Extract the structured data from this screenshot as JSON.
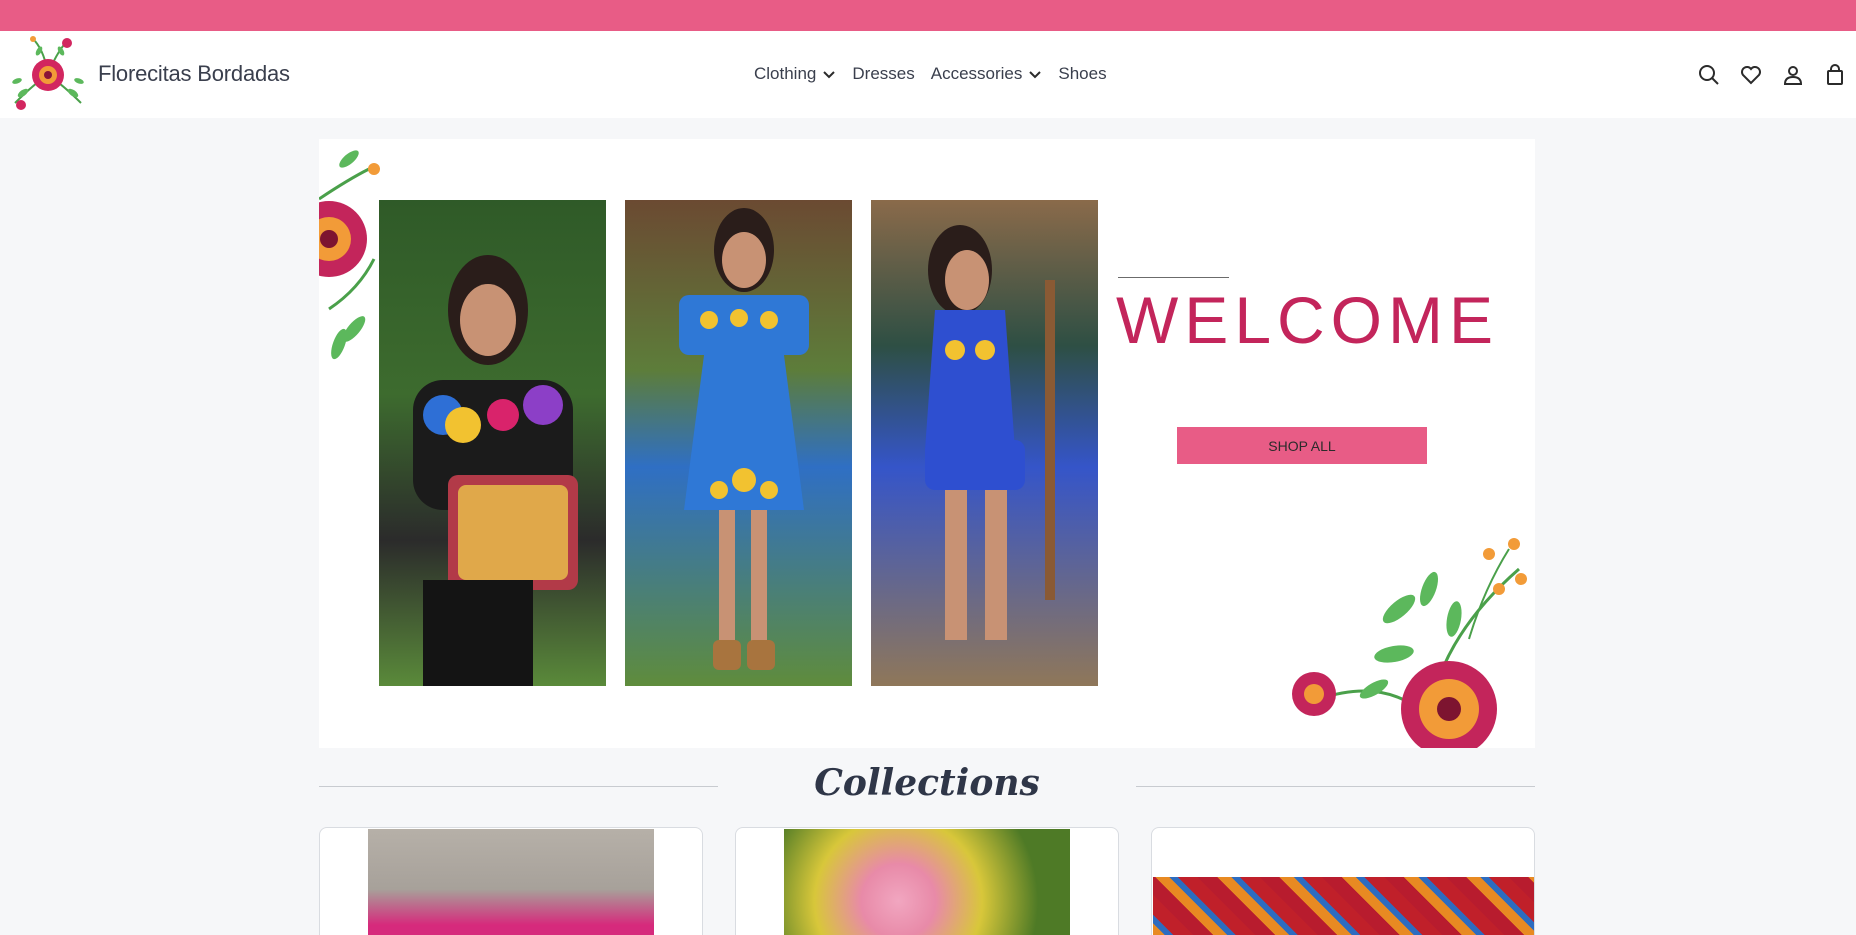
{
  "brand": {
    "name": "Florecitas Bordadas"
  },
  "nav": {
    "items": [
      {
        "label": "Clothing",
        "has_dropdown": true
      },
      {
        "label": "Dresses",
        "has_dropdown": false
      },
      {
        "label": "Accessories",
        "has_dropdown": true
      },
      {
        "label": "Shoes",
        "has_dropdown": false
      }
    ],
    "icons": [
      "search-icon",
      "heart-icon",
      "user-icon",
      "shopping-bag-icon"
    ]
  },
  "hero": {
    "title": "WELCOME",
    "cta_label": "SHOP ALL"
  },
  "collections": {
    "title": "Collections"
  },
  "colors": {
    "accent_pink": "#e85c86",
    "title_crimson": "#c3255b",
    "text_dark": "#3a3f4d"
  }
}
